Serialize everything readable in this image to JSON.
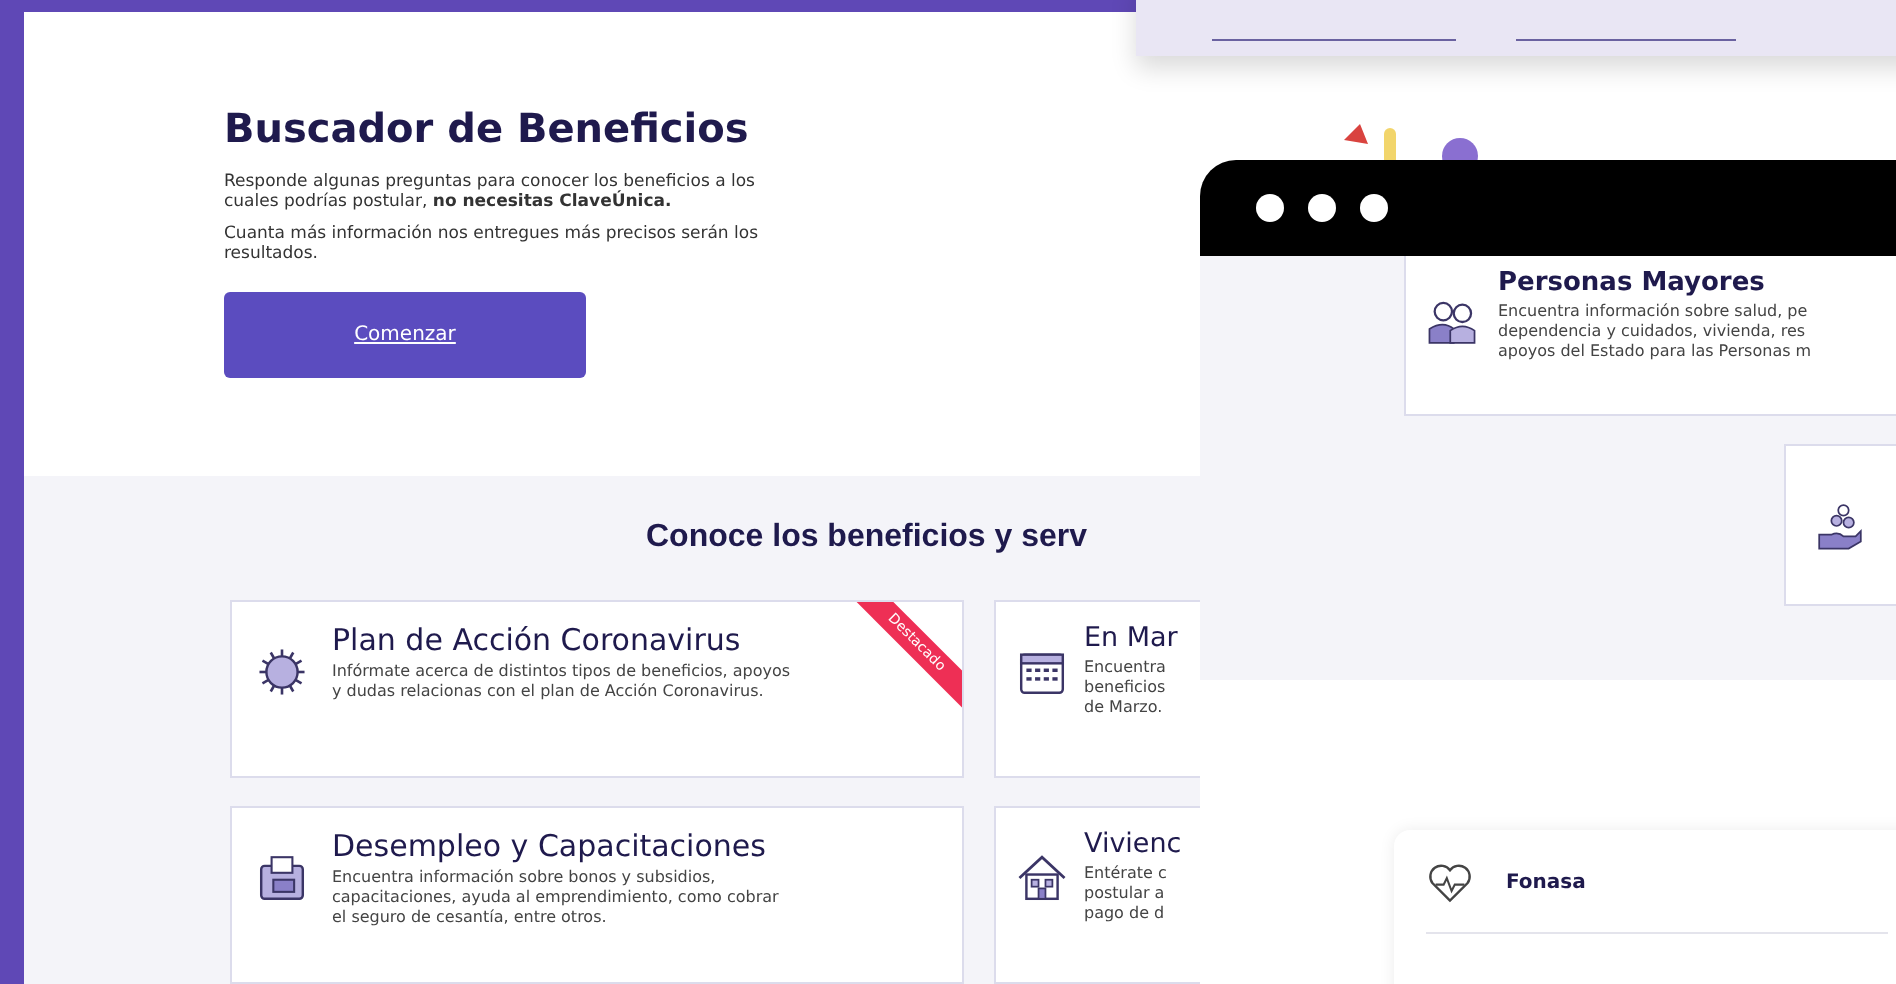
{
  "finder": {
    "title": "Buscador de Beneficios",
    "description": "Responde algunas preguntas para conocer los beneficios a los cuales podrías postular, **no necesitas ClaveÚnica.**",
    "note": "Cuanta más información nos entregues más precisos serán los resultados.",
    "button": "Comenzar"
  },
  "benefits": {
    "heading": "Conoce los beneficios y serv",
    "cards": [
      {
        "title": "Plan de Acción Coronavirus",
        "lines": [
          "Infórmate acerca de distintos tipos de beneficios, apoyos",
          "y dudas relacionas con el plan de Acción Coronavirus."
        ],
        "ribbon": "Destacado"
      },
      {
        "title": "En Mar",
        "lines": [
          "Encuentra",
          "beneficios",
          "de Marzo."
        ]
      },
      {
        "title": "Desempleo y Capacitaciones",
        "lines": [
          "Encuentra información sobre bonos y subsidios,",
          "capacitaciones, ayuda al emprendimiento, como cobrar",
          "el seguro de cesantía, entre otros."
        ]
      },
      {
        "title": "Vivienc",
        "lines": [
          "Entérate c",
          "postular a",
          "pago de d"
        ]
      }
    ]
  },
  "window": {
    "cards": [
      {
        "title": "Personas Mayores",
        "lines": [
          "Encuentra información sobre salud, pe",
          "dependencia y cuidados, vivienda, res",
          "apoyos del Estado para las Personas m"
        ]
      }
    ],
    "fonasa": {
      "title": "Fonasa"
    }
  }
}
